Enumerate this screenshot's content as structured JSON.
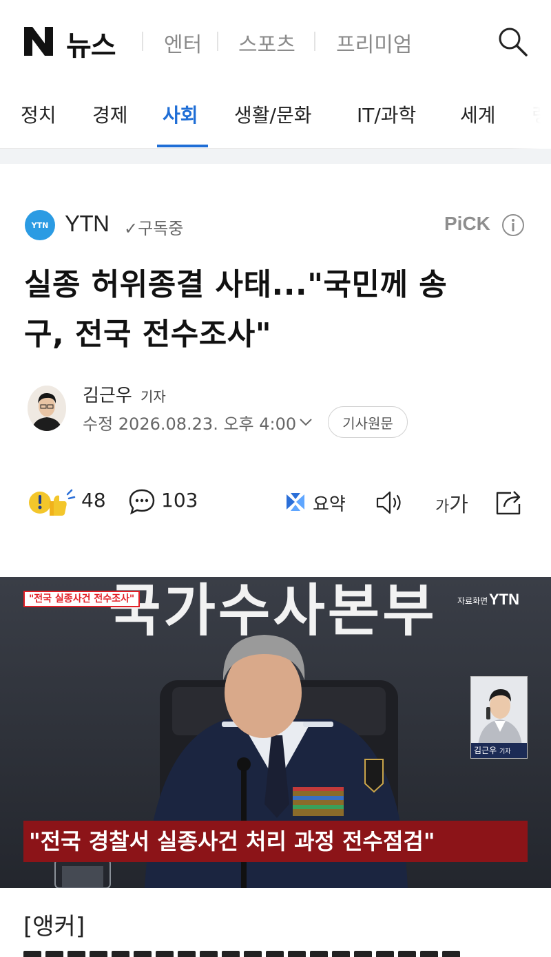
{
  "header": {
    "logo_mark": "N",
    "logo_label": "뉴스",
    "nav": [
      "엔터",
      "스포츠",
      "프리미엄"
    ]
  },
  "tabs": {
    "items": [
      "정치",
      "경제",
      "사회",
      "생활/문화",
      "IT/과학",
      "세계",
      "랭"
    ],
    "active": "사회"
  },
  "press": {
    "logo_text": "YTN",
    "name": "YTN",
    "subscribe_status": "구독중",
    "pick_label": "PiCK"
  },
  "article": {
    "headline_line1": "실종 허위종결 사태...\"국민께 송",
    "headline_line2": "구, 전국 전수조사\"",
    "reporter_name": "김근우",
    "reporter_role": "기자",
    "date_text": "수정 2026.08.23. 오후 4:00",
    "origin_button": "기사원문"
  },
  "actions": {
    "reaction_count": "48",
    "comment_count": "103",
    "summary_label": "요약",
    "font_size_small": "가",
    "font_size_large": "가"
  },
  "photo": {
    "tag_label": "\"전국 실종사건 전수조사\"",
    "backdrop_text": "국가수사본부",
    "archive_label": "자료화면",
    "channel_mark": "YTN",
    "inset_name": "김근우",
    "inset_role": "기자",
    "caption": "\"전국 경찰서 실종사건 처리 과정 전수점검\""
  },
  "body": {
    "anchor_tag": "[앵커]"
  },
  "colors": {
    "accent": "#1f6ed6",
    "caption_bar": "#8c1418",
    "press_logo": "#2b9be3",
    "tag_red": "#e21f26"
  }
}
